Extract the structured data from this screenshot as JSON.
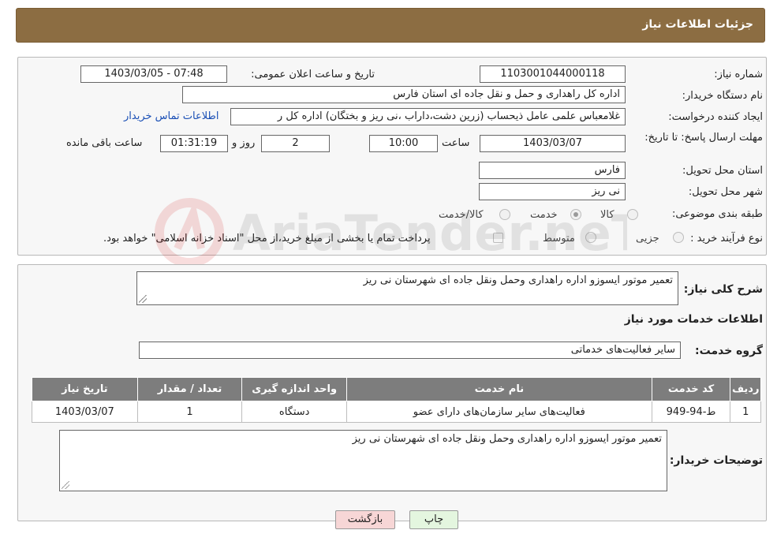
{
  "header": {
    "title": "جزئیات اطلاعات نیاز"
  },
  "form": {
    "need_number": {
      "label": "شماره نیاز:",
      "value": "1103001044000118"
    },
    "announce_datetime": {
      "label": "تاریخ و ساعت اعلان عمومی:",
      "value": "1403/03/05 - 07:48"
    },
    "buyer_org": {
      "label": "نام دستگاه خریدار:",
      "value": "اداره کل راهداری و حمل و نقل جاده ای استان فارس"
    },
    "requester": {
      "label": "ایجاد کننده درخواست:",
      "value": "غلامعباس علمی عامل ذیحساب (زرین دشت،داراب ،نی ریز و بختگان) اداره کل ر",
      "contact_link": "اطلاعات تماس خریدار"
    },
    "deadline": {
      "label": "مهلت ارسال پاسخ: تا تاریخ:",
      "date": "1403/03/07",
      "time_label": "ساعت",
      "time": "10:00",
      "days": "2",
      "days_label": "روز و",
      "remaining": "01:31:19",
      "remaining_label": "ساعت باقی مانده"
    },
    "delivery_province": {
      "label": "استان محل تحویل:",
      "value": "فارس"
    },
    "delivery_city": {
      "label": "شهر محل تحویل:",
      "value": "نی ریز"
    },
    "category": {
      "label": "طبقه بندی موضوعی:",
      "options": [
        {
          "label": "کالا",
          "checked": false
        },
        {
          "label": "خدمت",
          "checked": true
        },
        {
          "label": "کالا/خدمت",
          "checked": false
        }
      ]
    },
    "purchase_process": {
      "label": "نوع فرآیند خرید :",
      "options": [
        {
          "label": "جزیی",
          "checked": false
        },
        {
          "label": "متوسط",
          "checked": false
        }
      ],
      "payment_checkbox_label": "پرداخت تمام یا بخشی از مبلغ خرید،از محل \"اسناد خزانه اسلامی\" خواهد بود.",
      "payment_checked": false
    }
  },
  "description": {
    "label": "شرح کلی نیاز:",
    "value": "تعمیر موتور ایسوزو  اداره راهداری وحمل ونقل جاده ای شهرستان نی ریز"
  },
  "services": {
    "section_title": "اطلاعات خدمات مورد نیاز",
    "group_label": "گروه خدمت:",
    "group_value": "سایر فعالیت‌های خدماتی",
    "table": {
      "columns": [
        "ردیف",
        "کد خدمت",
        "نام خدمت",
        "واحد اندازه گیری",
        "تعداد / مقدار",
        "تاریخ نیاز"
      ],
      "rows": [
        [
          "1",
          "ط-94-949",
          "فعالیت‌های سایر سازمان‌های دارای عضو",
          "دستگاه",
          "1",
          "1403/03/07"
        ]
      ]
    }
  },
  "buyer_notes": {
    "label": "توضیحات خریدار:",
    "value": "تعمیر موتور ایسوزو  اداره راهداری وحمل ونقل جاده ای شهرستان نی ریز"
  },
  "buttons": {
    "print": "چاپ",
    "back": "بازگشت"
  },
  "watermark": {
    "text": "AriaTender.neT"
  }
}
